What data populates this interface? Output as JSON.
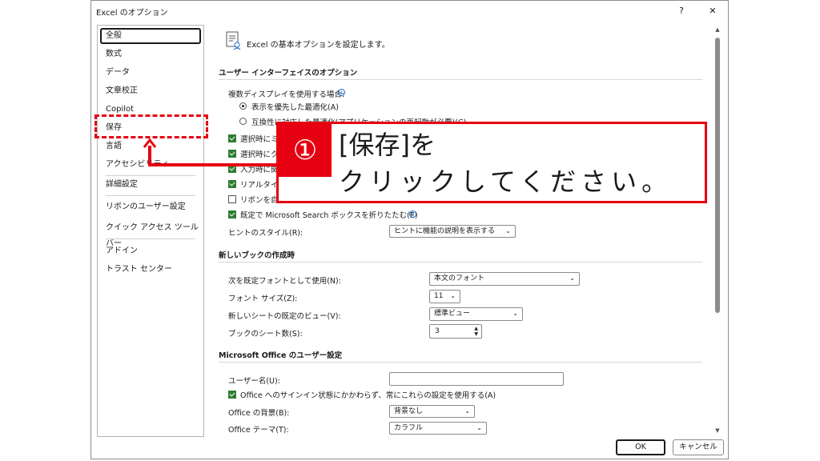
{
  "window": {
    "title": "Excel のオプション",
    "help_button": "?",
    "close_button": "✕"
  },
  "sidebar": {
    "items": [
      {
        "label": "全般"
      },
      {
        "label": "数式"
      },
      {
        "label": "データ"
      },
      {
        "label": "文章校正"
      },
      {
        "label": "Copilot"
      },
      {
        "label": "保存"
      },
      {
        "label": "言語"
      },
      {
        "label": "アクセシビリティ"
      },
      {
        "label": "詳細設定"
      },
      {
        "label": "リボンのユーザー設定"
      },
      {
        "label": "クイック アクセス ツール バー"
      },
      {
        "label": "アドイン"
      },
      {
        "label": "トラスト センター"
      }
    ],
    "selected": "全般",
    "highlighted": "保存"
  },
  "main": {
    "header": "Excel の基本オプションを設定します。",
    "ui_section": {
      "title": "ユーザー インターフェイスのオプション",
      "multi_display_label": "複数ディスプレイを使用する場合:",
      "radio_optimize": "表示を優先した最適化(A)",
      "radio_compat": "互換性に対応した最適化(アプリケーションの再起動が必要)(C)",
      "mini_toolbar": "選択時にミニ ツール バーを表示する(M)",
      "quick_analysis": "選択時にクイック分析オプションを表示する(Q)",
      "autocomplete": "入力時に関数の候補を表示する(D)",
      "live_preview": "リアルタイムのプレビュー表示機能を有効にする(L)",
      "ribbon_collapse": "リボンを自動的に折りたたむ(N)",
      "search_collapse": "既定で Microsoft Search ボックスを折りたたむ(E)",
      "tooltip_label": "ヒントのスタイル(R):",
      "tooltip_value": "ヒントに機能の説明を表示する"
    },
    "new_book_section": {
      "title": "新しいブックの作成時",
      "font_label": "次を既定フォントとして使用(N):",
      "font_value": "本文のフォント",
      "size_label": "フォント サイズ(Z):",
      "size_value": "11",
      "view_label": "新しいシートの既定のビュー(V):",
      "view_value": "標準ビュー",
      "sheets_label": "ブックのシート数(S):",
      "sheets_value": "3"
    },
    "user_section": {
      "title": "Microsoft Office のユーザー設定",
      "username_label": "ユーザー名(U):",
      "username_value": "",
      "always_use": "Office へのサインイン状態にかかわらず、常にこれらの設定を使用する(A)",
      "background_label": "Office の背景(B):",
      "background_value": "背景なし",
      "theme_label": "Office テーマ(T):",
      "theme_value": "カラフル"
    }
  },
  "footer": {
    "ok": "OK",
    "cancel": "キャンセル"
  },
  "callout": {
    "number": "①",
    "line1": "[保存]を",
    "line2": "クリックしてください。"
  },
  "colors": {
    "accent_red": "#e60012",
    "checkbox_green": "#2e7d32",
    "info_blue": "#1b6ac9"
  }
}
